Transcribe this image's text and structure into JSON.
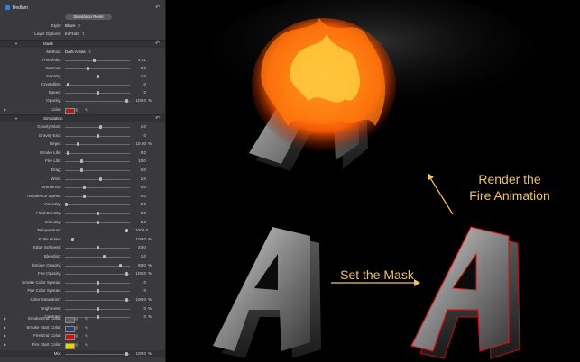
{
  "panel": {
    "title": "Bedlam",
    "simulation_reset": "Simulation Reset",
    "style": {
      "label": "Style:",
      "value": "Blaze"
    },
    "layer_options": {
      "label": "Layer Options:",
      "value": "In Front"
    },
    "mask_section": "Mask",
    "mask_rows": [
      {
        "kind": "popup",
        "label": "Method:",
        "value": "Dark Areas"
      },
      {
        "kind": "slider",
        "label": "Threshold:",
        "value": "4.81",
        "unit": "",
        "level": 0.45
      },
      {
        "kind": "slider",
        "label": "Gamma:",
        "value": "0.2",
        "unit": "",
        "level": 0.35
      },
      {
        "kind": "slider",
        "label": "Density:",
        "value": "1.0",
        "unit": "",
        "level": 0.5
      },
      {
        "kind": "slider",
        "label": "Crystallize:",
        "value": "0",
        "unit": "",
        "level": 0.05
      },
      {
        "kind": "slider",
        "label": "Speed:",
        "value": "0",
        "unit": "",
        "level": 0.5
      },
      {
        "kind": "slider",
        "label": "Opacity:",
        "value": "100.0",
        "unit": "%",
        "level": 0.95
      }
    ],
    "color_row": {
      "label": "Color:",
      "swatch": "#cc1010"
    },
    "simulation_section": "Simulation",
    "sim_rows": [
      {
        "label": "Gravity Start:",
        "value": "1.0",
        "unit": "",
        "level": 0.55
      },
      {
        "label": "Gravity End:",
        "value": "0",
        "unit": "",
        "level": 0.5
      },
      {
        "label": "Repel:",
        "value": "10.00",
        "unit": "%",
        "level": 0.2
      },
      {
        "label": "Smoke Life:",
        "value": "0.0",
        "unit": "",
        "level": 0.05
      },
      {
        "label": "Fire Life:",
        "value": "10.0",
        "unit": "",
        "level": 0.25
      },
      {
        "label": "Drag:",
        "value": "0.0",
        "unit": "",
        "level": 0.25
      },
      {
        "label": "Wind:",
        "value": "1.0",
        "unit": "",
        "level": 0.55
      },
      {
        "label": "Turbulence:",
        "value": "0.0",
        "unit": "",
        "level": 0.3
      },
      {
        "label": "Turbulence Speed:",
        "value": "0.0",
        "unit": "",
        "level": 0.3
      },
      {
        "label": "Viscosity:",
        "value": "0.0",
        "unit": "",
        "level": 0.02
      },
      {
        "label": "Fluid Density:",
        "value": "0.0",
        "unit": "",
        "level": 0.5
      },
      {
        "label": "Intensity:",
        "value": "0.0",
        "unit": "",
        "level": 0.5
      },
      {
        "label": "Temperature:",
        "value": "1000.0",
        "unit": "",
        "level": 0.95
      },
      {
        "label": "Scale Noise:",
        "value": "100.0",
        "unit": "%",
        "level": 0.12
      },
      {
        "label": "Edge Softness:",
        "value": "20.0",
        "unit": "",
        "level": 0.5
      },
      {
        "label": "Blending:",
        "value": "1.0",
        "unit": "",
        "level": 0.6
      },
      {
        "label": "Smoke Opacity:",
        "value": "80.0",
        "unit": "%",
        "level": 0.85
      },
      {
        "label": "Fire Opacity:",
        "value": "100.0",
        "unit": "%",
        "level": 0.95
      },
      {
        "label": "Smoke Color Spread:",
        "value": "0",
        "unit": "",
        "level": 0.5
      },
      {
        "label": "Fire Color Spread:",
        "value": "0",
        "unit": "",
        "level": 0.5
      },
      {
        "label": "Color Saturation:",
        "value": "100.0",
        "unit": "%",
        "level": 0.95
      },
      {
        "label": "Brightness:",
        "value": "0",
        "unit": "%",
        "level": 0.5
      },
      {
        "label": "Contrast:",
        "value": "0",
        "unit": "%",
        "level": 0.5
      }
    ],
    "color_rows": [
      {
        "label": "Smoke End Color:",
        "swatch": "#5a5a5a"
      },
      {
        "label": "Smoke Start Color:",
        "swatch": "#2a3a8a"
      },
      {
        "label": "Fire End Color:",
        "swatch": "#cc1010"
      },
      {
        "label": "Fire Start Color:",
        "swatch": "#f0d000"
      }
    ],
    "mix": {
      "label": "Mix:",
      "value": "100.0",
      "unit": "%",
      "level": 0.95
    }
  },
  "canvas": {
    "label_render": "Render the\nFire Animation",
    "label_mask": "Set the Mask",
    "accent": "#f2c260",
    "letter": "A"
  }
}
